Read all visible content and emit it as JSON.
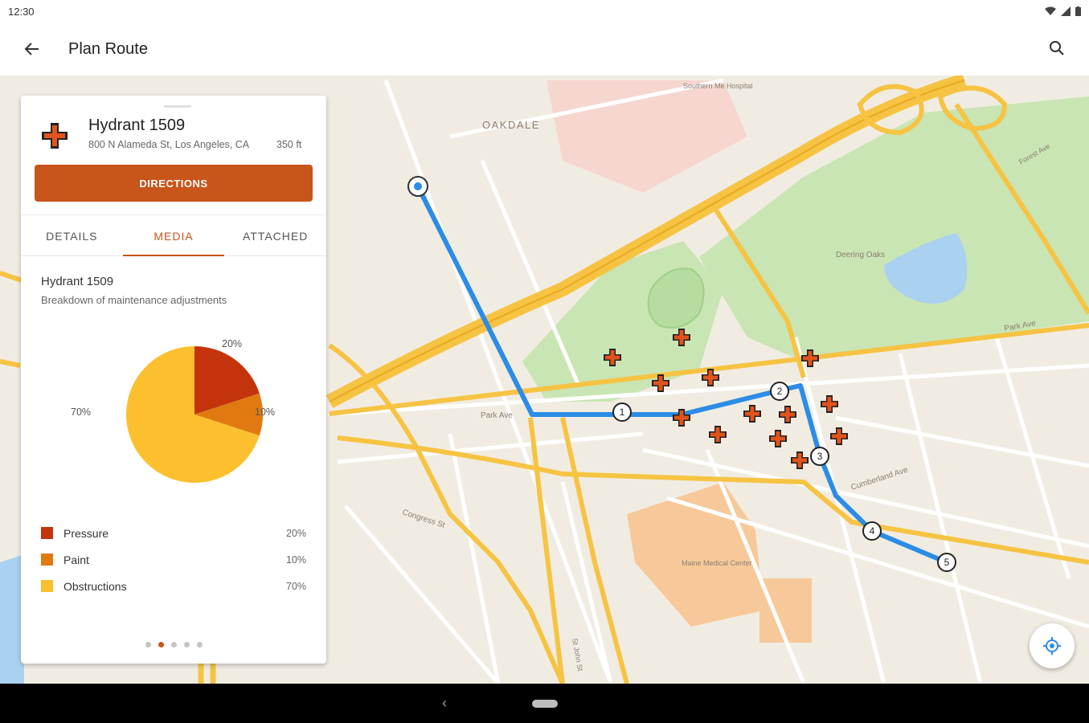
{
  "status_bar": {
    "time": "12:30"
  },
  "app_bar": {
    "title": "Plan Route",
    "back_icon": "arrow-left-icon",
    "search_icon": "search-icon"
  },
  "map": {
    "labels": {
      "oakdale": "OAKDALE",
      "southern_medical": "Southern Me Hospital",
      "deering_oaks": "Deering Oaks",
      "park_ave_left": "Park Ave",
      "park_ave_right": "Park Ave",
      "congress_st": "Congress St",
      "cumberland_ave": "Cumberland Ave",
      "maine_medical": "Maine Medical Center",
      "st_john_st": "St John St",
      "forest_ave": "Forest Ave"
    },
    "route_stops": [
      "1",
      "2",
      "3",
      "4",
      "5"
    ],
    "colors": {
      "route": "#2b8de6",
      "hydrant": "#e2531c",
      "highway": "#f6c343",
      "park": "#c9e5b3",
      "water": "#aad1f0"
    }
  },
  "card": {
    "title": "Hydrant 1509",
    "address": "800 N Alameda St, Los Angeles, CA",
    "distance": "350 ft",
    "directions_label": "DIRECTIONS",
    "tabs": [
      {
        "label": "DETAILS",
        "active": false
      },
      {
        "label": "MEDIA",
        "active": true
      },
      {
        "label": "ATTACHED",
        "active": false
      }
    ],
    "media": {
      "title": "Hydrant 1509",
      "subtitle": "Breakdown of maintenance adjustments"
    },
    "pager": {
      "count": 5,
      "active_index": 1
    }
  },
  "chart_data": {
    "type": "pie",
    "title": "",
    "slices": [
      {
        "label": "Pressure",
        "value": 20,
        "display": "20%",
        "color": "#c4340c"
      },
      {
        "label": "Paint",
        "value": 10,
        "display": "10%",
        "color": "#e07a10"
      },
      {
        "label": "Obstructions",
        "value": 70,
        "display": "70%",
        "color": "#fcc02e"
      }
    ]
  },
  "nav": {
    "back_icon": "triangle-back-icon",
    "home_icon": "home-pill-icon"
  },
  "locate_button": {
    "icon": "my-location-icon"
  }
}
